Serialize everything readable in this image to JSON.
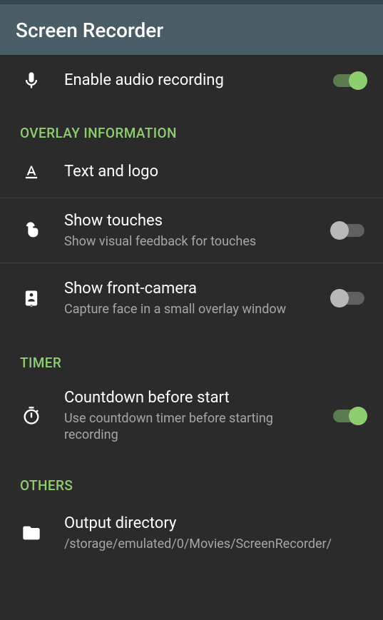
{
  "header": {
    "title": "Screen Recorder"
  },
  "audio": {
    "title": "Enable audio recording",
    "toggle": true
  },
  "sections": {
    "overlay": {
      "label": "OVERLAY INFORMATION",
      "textlogo": {
        "title": "Text and logo"
      },
      "touches": {
        "title": "Show touches",
        "subtitle": "Show visual feedback for touches",
        "toggle": false
      },
      "frontcam": {
        "title": "Show front-camera",
        "subtitle": "Capture face in a small overlay window",
        "toggle": false
      }
    },
    "timer": {
      "label": "TIMER",
      "countdown": {
        "title": "Countdown before start",
        "subtitle": "Use countdown timer before starting recording",
        "toggle": true
      }
    },
    "others": {
      "label": "OTHERS",
      "output": {
        "title": "Output directory",
        "subtitle": "/storage/emulated/0/Movies/ScreenRecorder/"
      }
    }
  }
}
